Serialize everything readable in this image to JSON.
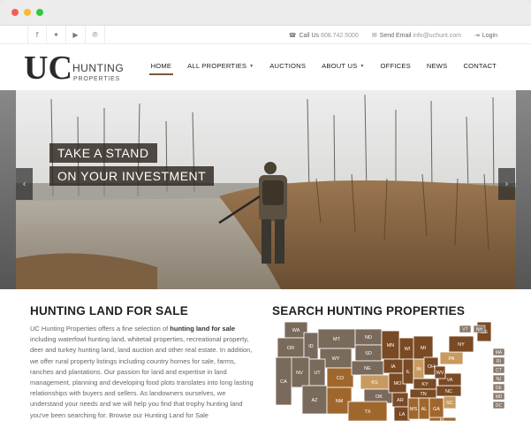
{
  "topbar": {
    "social": [
      {
        "name": "facebook-icon",
        "glyph": "f"
      },
      {
        "name": "twitter-icon",
        "glyph": "🐦"
      },
      {
        "name": "youtube-icon",
        "glyph": "▶"
      },
      {
        "name": "pinterest-icon",
        "glyph": "℗"
      }
    ],
    "call_label": "Call Us",
    "call_number": "608.742.5000",
    "email_label": "Send Email",
    "email_address": "info@uchunt.com",
    "login_label": "Login"
  },
  "logo": {
    "mark": "UC",
    "word1": "HUNTING",
    "word2": "PROPERTIES"
  },
  "nav": [
    {
      "label": "HOME",
      "active": true,
      "dropdown": false
    },
    {
      "label": "ALL PROPERTIES",
      "active": false,
      "dropdown": true
    },
    {
      "label": "AUCTIONS",
      "active": false,
      "dropdown": false
    },
    {
      "label": "ABOUT US",
      "active": false,
      "dropdown": true
    },
    {
      "label": "OFFICES",
      "active": false,
      "dropdown": false
    },
    {
      "label": "NEWS",
      "active": false,
      "dropdown": false
    },
    {
      "label": "CONTACT",
      "active": false,
      "dropdown": false
    }
  ],
  "hero": {
    "caption_line1": "TAKE A STAND",
    "caption_line2": "ON YOUR INVESTMENT"
  },
  "land": {
    "title": "HUNTING LAND FOR SALE",
    "p1": "UC Hunting Properties offers a fine selection of ",
    "p1_bold": "hunting land for sale",
    "p2": " including waterfowl hunting land, whitetail properties, recreational property, deer and turkey hunting land, land auction and other real estate. In addition, we offer rural property listings including country homes for sale, farms, ranches and plantations. Our passion for land and expertise in land management, planning and developing food plots translates into long lasting relationships with buyers and sellers. As landowners ourselves, we understand your needs and we will help you find that trophy hunting land you've been searching for. Browse our Hunting Land for Sale"
  },
  "search": {
    "title": "SEARCH HUNTING PROPERTIES",
    "states": [
      "WA",
      "OR",
      "ID",
      "MT",
      "ND",
      "SD",
      "WY",
      "NV",
      "CA",
      "UT",
      "CO",
      "NE",
      "KS",
      "AZ",
      "NM",
      "OK",
      "TX",
      "MN",
      "IA",
      "MO",
      "AR",
      "LA",
      "WI",
      "IL",
      "MI",
      "IN",
      "OH",
      "KY",
      "TN",
      "MS",
      "AL",
      "GA",
      "FL",
      "SC",
      "NC",
      "VA",
      "WV",
      "PA",
      "NY",
      "ME"
    ],
    "small_states": [
      "VT",
      "NH",
      "MA",
      "RI",
      "CT",
      "NJ",
      "DE",
      "MD",
      "DC"
    ]
  }
}
